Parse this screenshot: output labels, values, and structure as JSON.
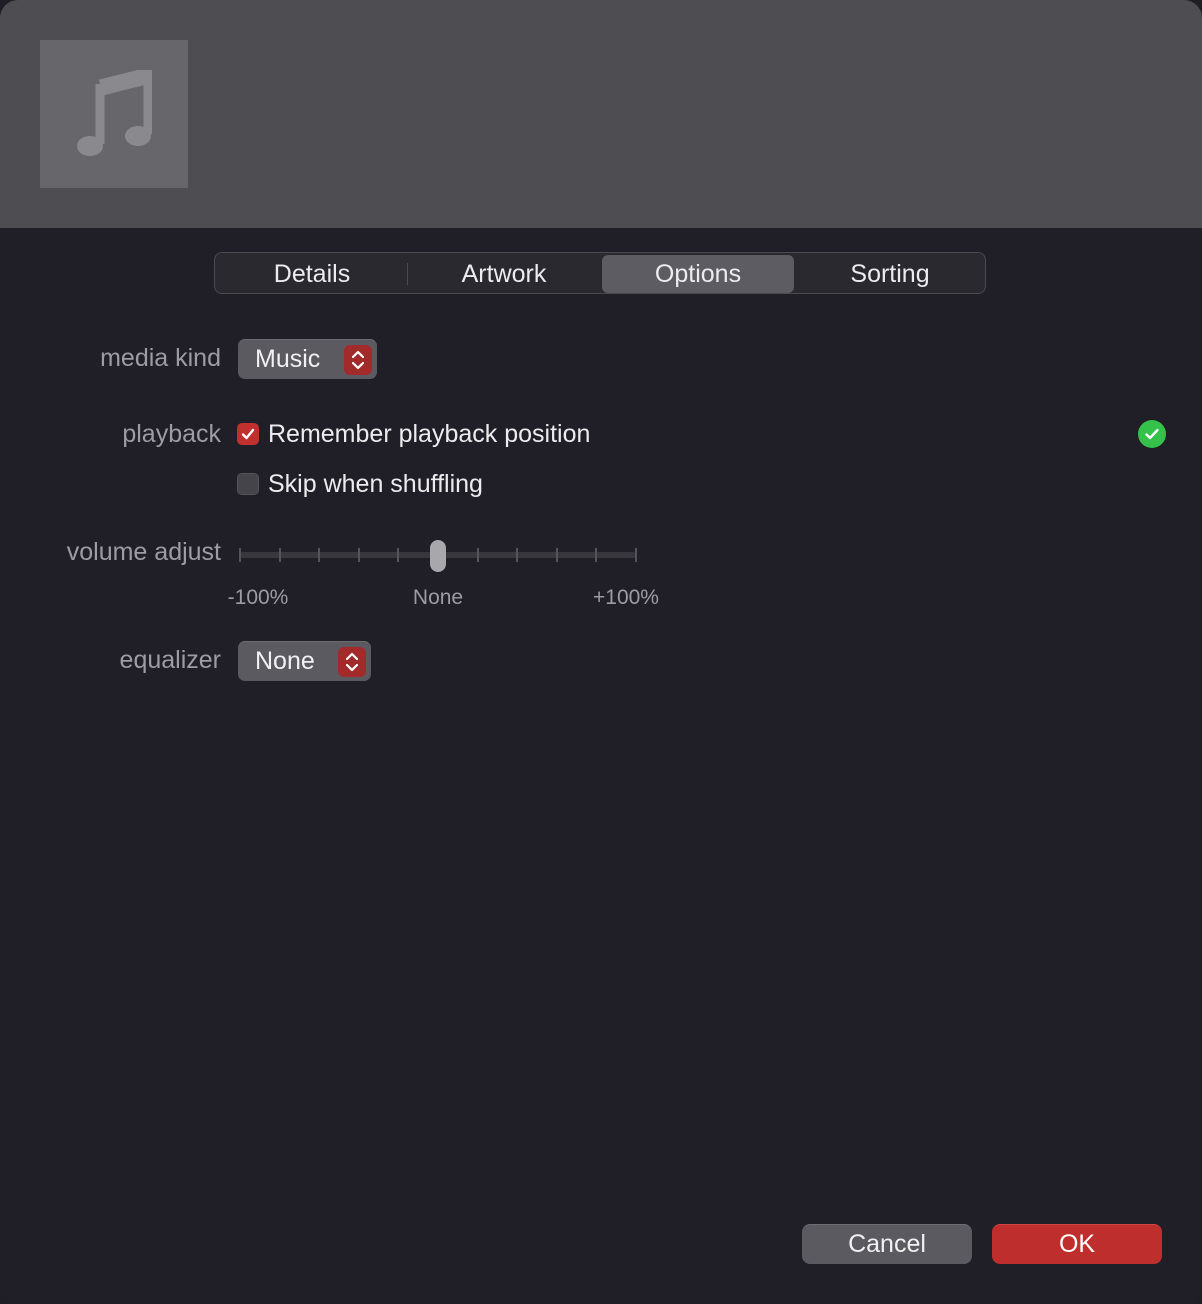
{
  "colors": {
    "accent": "#bd2e2c",
    "success": "#34c24a",
    "background": "#201f27",
    "header": "#4e4d52"
  },
  "header": {
    "artwork_icon": "music-note-icon"
  },
  "tabs": [
    {
      "label": "Details",
      "active": false
    },
    {
      "label": "Artwork",
      "active": false
    },
    {
      "label": "Options",
      "active": true
    },
    {
      "label": "Sorting",
      "active": false
    }
  ],
  "options": {
    "media_kind": {
      "label": "media kind",
      "value": "Music"
    },
    "playback": {
      "label": "playback",
      "remember_position": {
        "label": "Remember playback position",
        "checked": true
      },
      "skip_shuffling": {
        "label": "Skip when shuffling",
        "checked": false
      },
      "status_icon": "checkmark-circle-icon"
    },
    "volume_adjust": {
      "label": "volume adjust",
      "min_label": "-100%",
      "mid_label": "None",
      "max_label": "+100%",
      "value_percent": 0
    },
    "equalizer": {
      "label": "equalizer",
      "value": "None"
    }
  },
  "buttons": {
    "cancel": "Cancel",
    "ok": "OK"
  }
}
